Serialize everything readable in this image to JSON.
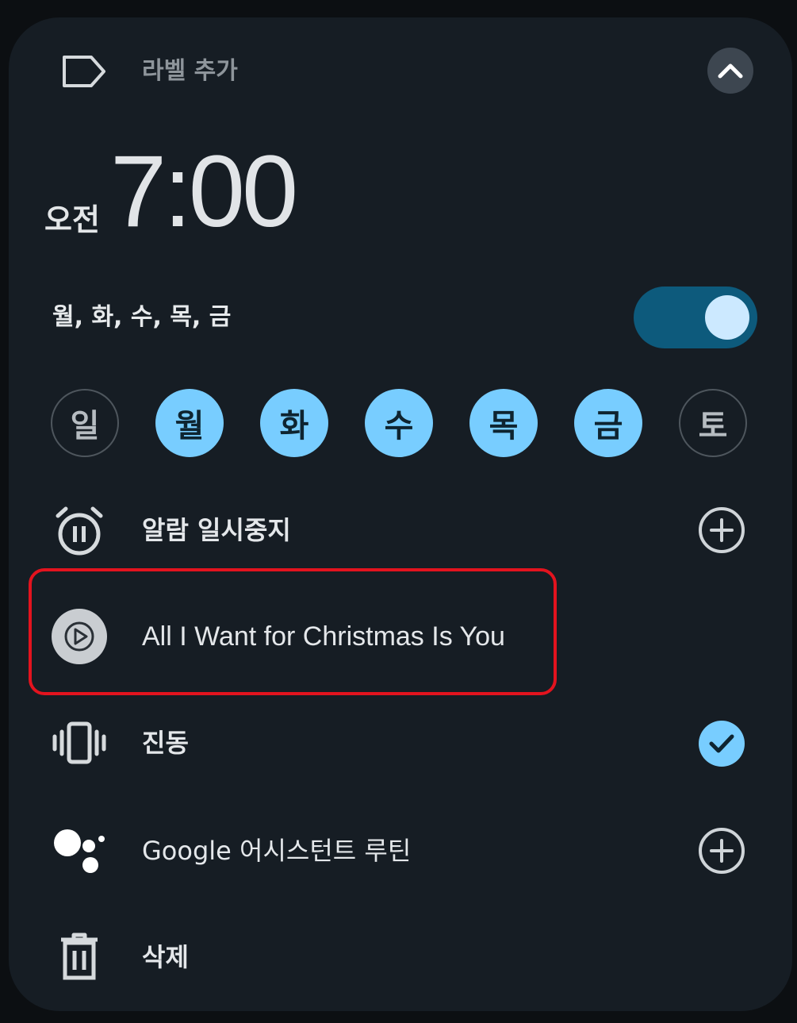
{
  "header": {
    "label_placeholder": "라벨 추가"
  },
  "alarm": {
    "ampm": "오전",
    "time": "7:00",
    "repeat_summary": "월, 화, 수, 목, 금",
    "enabled": true
  },
  "days": [
    {
      "label": "일",
      "selected": false
    },
    {
      "label": "월",
      "selected": true
    },
    {
      "label": "화",
      "selected": true
    },
    {
      "label": "수",
      "selected": true
    },
    {
      "label": "목",
      "selected": true
    },
    {
      "label": "금",
      "selected": true
    },
    {
      "label": "토",
      "selected": false
    }
  ],
  "rows": {
    "pause": {
      "label": "알람 일시중지",
      "icon": "alarm-pause-icon"
    },
    "ringtone": {
      "label": "All I Want for Christmas Is You",
      "icon": "play-icon"
    },
    "vibrate": {
      "label": "진동",
      "icon": "vibrate-icon",
      "checked": true
    },
    "assistant": {
      "label": "Google 어시스턴트 루틴",
      "icon": "google-assistant-icon"
    },
    "delete": {
      "label": "삭제",
      "icon": "trash-icon"
    }
  },
  "colors": {
    "accent": "#78cdff",
    "toggle_track": "#0d5a7c",
    "highlight": "#e3131e",
    "card_bg": "#161d24"
  }
}
